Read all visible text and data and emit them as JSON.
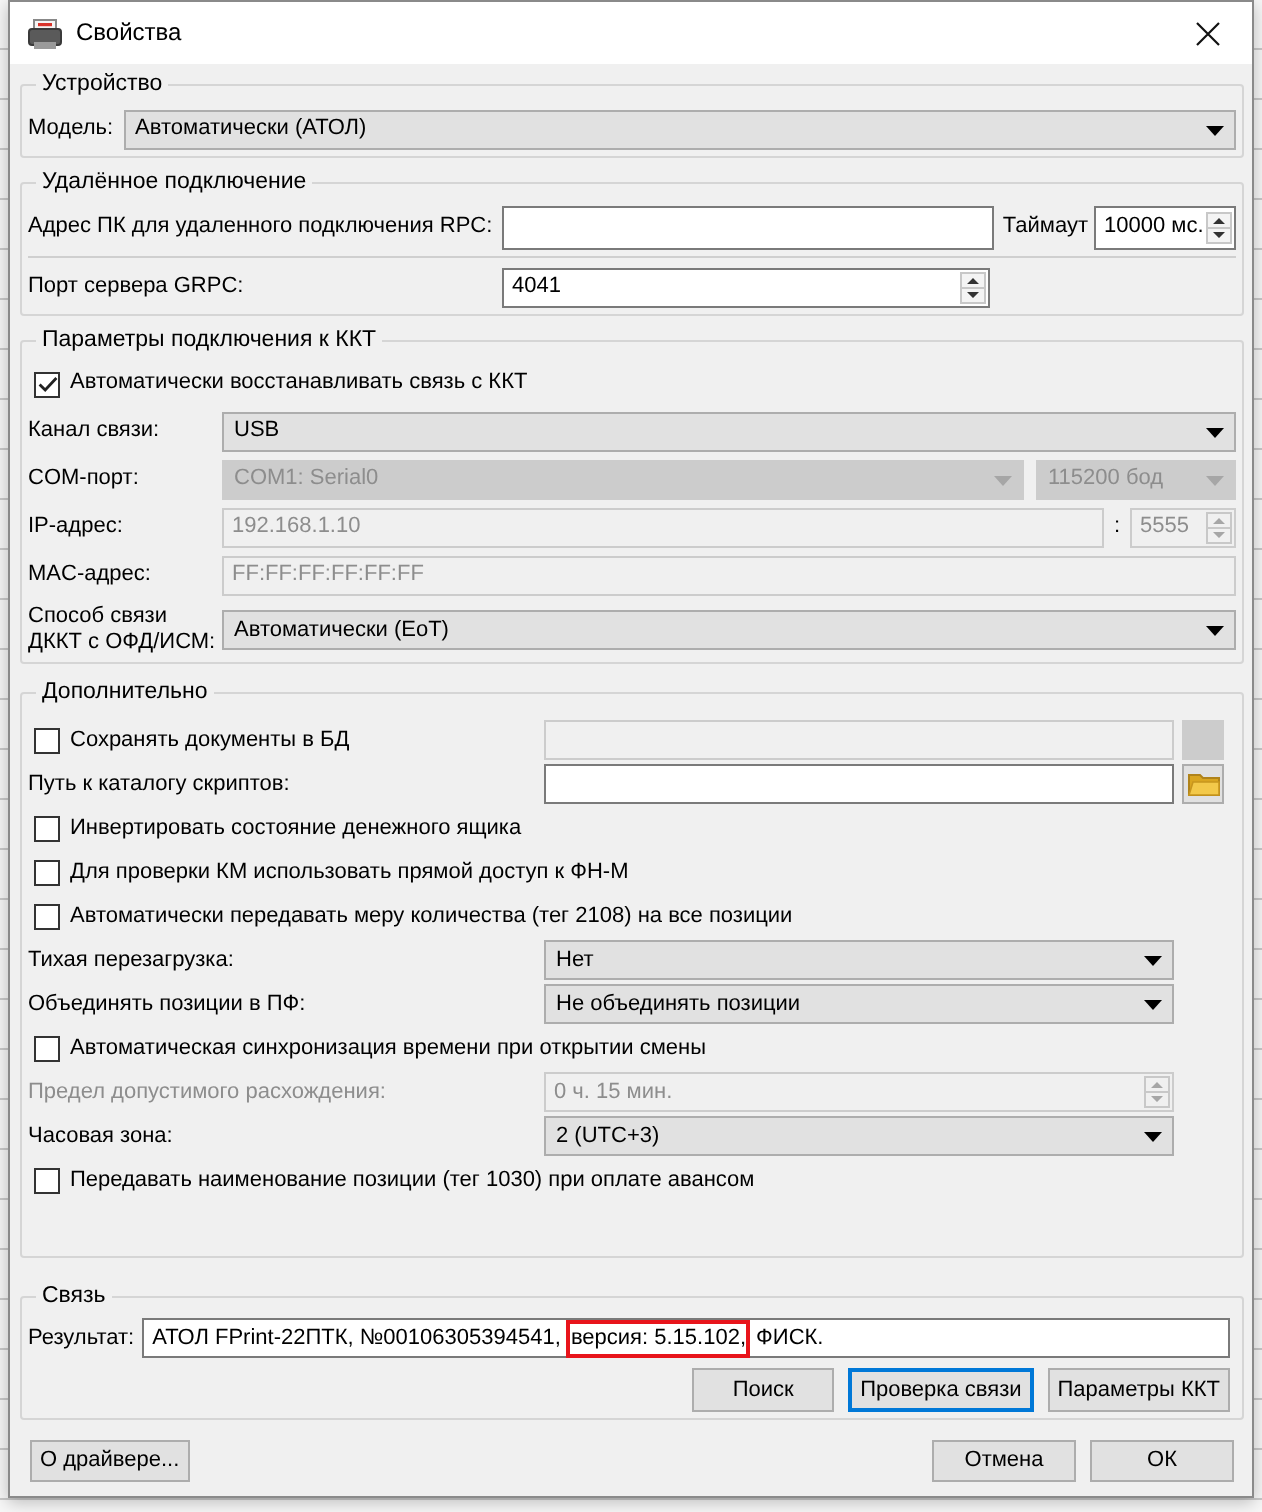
{
  "window": {
    "title": "Свойства"
  },
  "device": {
    "legend": "Устройство",
    "model": {
      "label": "Модель:",
      "value": "Автоматически (АТОЛ)"
    }
  },
  "remote": {
    "legend": "Удалённое подключение",
    "address": {
      "label": "Адрес ПК для удаленного подключения RPC:"
    },
    "timeout": {
      "label": "Таймаут",
      "value": "10000 мс."
    },
    "grpc_port": {
      "label": "Порт сервера GRPC:",
      "value": "4041"
    }
  },
  "connection": {
    "legend": "Параметры подключения к ККТ",
    "rows": [
      {
        "kind": "checkbox",
        "label": "Автоматически восстанавливать связь с ККТ",
        "checked": true,
        "disabled": false
      },
      {
        "kind": "combo",
        "label": "Канал связи:",
        "value": "USB",
        "disabled": false
      },
      {
        "kind": "combo_pair",
        "label": "COM-порт:",
        "value": "COM1: Serial0",
        "value_2": "115200 бод",
        "disabled": true
      },
      {
        "kind": "address",
        "label": "IP-адрес:",
        "value": "192.168.1.10",
        "separator": ":",
        "port": "5555",
        "disabled": true
      },
      {
        "kind": "input",
        "label": "MAC-адрес:",
        "value": "FF:FF:FF:FF:FF:FF",
        "disabled": true
      },
      {
        "kind": "combo",
        "label": "Способ связи ДККТ с ОФД/ИСМ:",
        "value": "Автоматически (EoT)",
        "disabled": false
      }
    ]
  },
  "extra": {
    "legend": "Дополнительно",
    "rows": [
      {
        "kind": "checkbox_field",
        "label": "Сохранять документы в БД",
        "checked": false,
        "disabled": true
      },
      {
        "kind": "path",
        "label": "Путь к каталогу скриптов:",
        "disabled": false
      },
      {
        "kind": "checkbox",
        "label": "Инвертировать состояние денежного ящика",
        "checked": false,
        "disabled": false
      },
      {
        "kind": "checkbox",
        "label": "Для проверки КМ использовать прямой доступ к ФН-М",
        "checked": false,
        "disabled": false
      },
      {
        "kind": "checkbox",
        "label": "Автоматически передавать меру количества (тег 2108) на все позиции",
        "checked": false,
        "disabled": false
      },
      {
        "kind": "combo",
        "label": "Тихая перезагрузка:",
        "value": "Нет",
        "disabled": false
      },
      {
        "kind": "combo",
        "label": "Объединять позиции в ПФ:",
        "value": "Не объединять позиции",
        "disabled": false
      },
      {
        "kind": "checkbox",
        "label": "Автоматическая синхронизация времени при открытии смены",
        "checked": false,
        "disabled": false
      },
      {
        "kind": "spin",
        "label": "Предел допустимого расхождения:",
        "value": "0 ч. 15 мин.",
        "disabled": true
      },
      {
        "kind": "combo",
        "label": "Часовая зона:",
        "value": "2 (UTC+3)",
        "disabled": false
      },
      {
        "kind": "checkbox",
        "label": "Передавать наименование позиции (тег 1030) при оплате авансом",
        "checked": false,
        "disabled": false
      }
    ]
  },
  "link": {
    "legend": "Связь",
    "result": {
      "label": "Результат:",
      "parts": [
        {
          "text": "АТОЛ FPrint-22ПТК, №00106305394541, ",
          "highlighted": false
        },
        {
          "text": "версия: 5.15.102,",
          "highlighted": true
        },
        {
          "text": " ФИСК.",
          "highlighted": false
        }
      ]
    },
    "buttons": [
      {
        "label": "Поиск",
        "focused": false
      },
      {
        "label": "Проверка связи",
        "focused": true
      },
      {
        "label": "Параметры ККТ",
        "focused": false
      }
    ]
  },
  "footer": {
    "about_button": "О драйвере...",
    "buttons": [
      {
        "label": "Отмена"
      },
      {
        "label": "ОК"
      }
    ]
  }
}
